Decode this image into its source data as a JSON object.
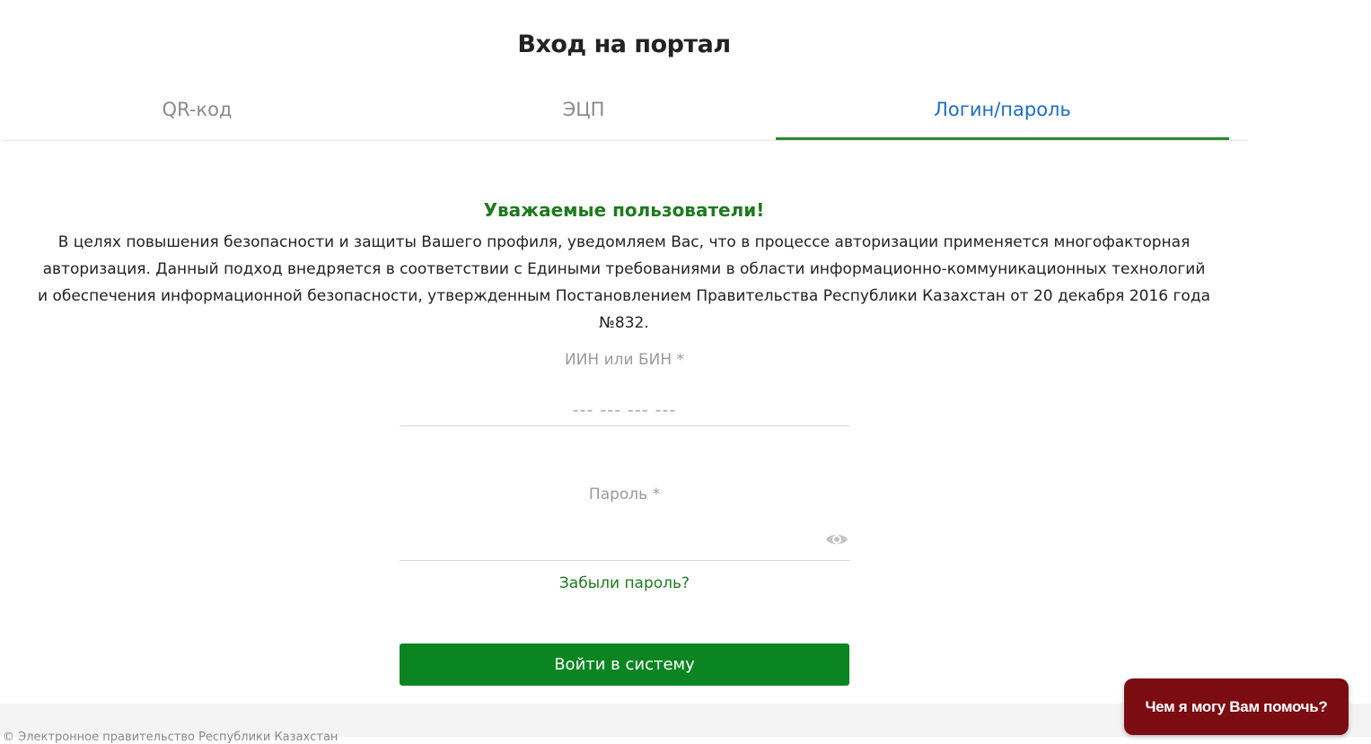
{
  "page": {
    "title": "Вход на портал"
  },
  "tabs": [
    {
      "label": "QR-код",
      "active": false
    },
    {
      "label": "ЭЦП",
      "active": false
    },
    {
      "label": "Логин/пароль",
      "active": true
    }
  ],
  "notice": {
    "heading": "Уважаемые пользователи!",
    "text": "В целях повышения безопасности и защиты Вашего профиля, уведомляем Вас, что в процессе авторизации применяется многофакторная авторизация. Данный подход внедряется в соответствии с Едиными требованиями в области информационно-коммуникационных технологий и обеспечения информационной безопасности, утвержденным Постановлением Правительства Республики Казахстан от 20 декабря 2016 года №832."
  },
  "form": {
    "iin_label": "ИИН или БИН *",
    "iin_placeholder": "--- --- --- ---",
    "iin_value": "",
    "password_label": "Пароль *",
    "password_placeholder": "",
    "password_value": "",
    "forgot_link": "Забыли пароль?",
    "submit_label": "Войти в систему"
  },
  "footer": {
    "text": "© Электронное правительство Республики Казахстан"
  },
  "help_chat": {
    "label": "Чем я могу Вам помочь?"
  },
  "colors": {
    "accent_green": "#0b8522",
    "active_tab_text": "#1b6ec2",
    "chat_bg": "#7a0c12"
  },
  "icons": {
    "password_toggle": "eye-icon"
  }
}
